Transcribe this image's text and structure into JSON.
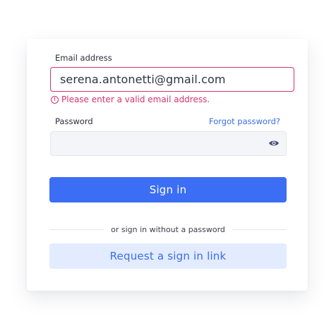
{
  "form": {
    "email": {
      "label": "Email address",
      "value": "serena.antonetti@gmail.com",
      "error": "Please enter a valid email address."
    },
    "password": {
      "label": "Password",
      "forgot_link": "Forgot password?",
      "value": "",
      "toggle_icon": "eye-icon"
    },
    "signin_button": "Sign in",
    "divider_text": "or sign in without a password",
    "link_button": "Request a sign in link"
  },
  "colors": {
    "primary": "#3b6ef5",
    "error": "#d6336c",
    "link": "#3a6ee8",
    "secondary_button_bg": "#e3ebfe"
  }
}
